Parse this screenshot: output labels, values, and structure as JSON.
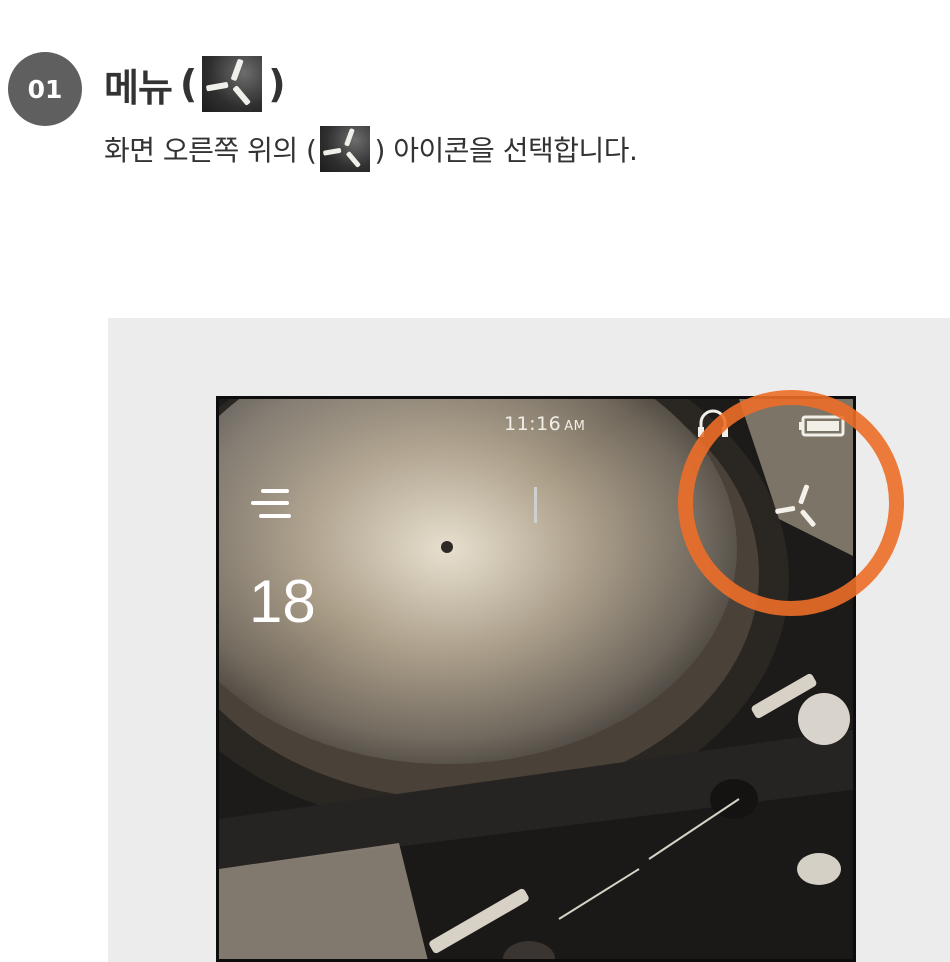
{
  "step": {
    "number": "01",
    "title_text": "메뉴",
    "title_paren_open": "(",
    "title_paren_close": ")",
    "description_before": "화면 오른쪽 위의 (",
    "description_after": ") 아이콘을 선택합니다."
  },
  "device_screen": {
    "status_bar": {
      "time": "11:16",
      "ampm": "AM"
    },
    "volume_value": "18"
  },
  "icons": {
    "menu": "menu-icon",
    "list": "list-icon",
    "headphone": "headphone-icon",
    "battery": "battery-icon"
  },
  "colors": {
    "badge": "#5f5f5f",
    "highlight": "#ec6e28",
    "panel_bg": "#ececec"
  }
}
